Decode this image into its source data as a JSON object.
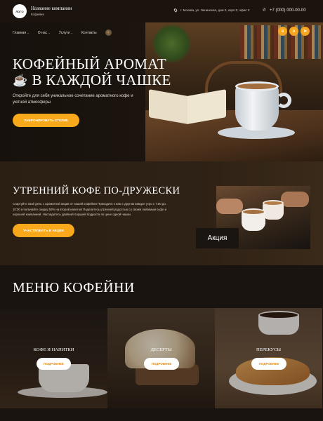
{
  "colors": {
    "accent": "#f7a81b",
    "background": "#17120d",
    "text": "#ffffff"
  },
  "header": {
    "logo_text": "ЛОГО",
    "company_name": "Название компании",
    "company_sub": "Кофейня",
    "address": "г. Москва, ул. Ленинская, дом 0, корп 0, офис 0",
    "phone": "+7 (000) 000-00-00",
    "address_icon": "map-pin-icon",
    "phone_icon": "phone-icon"
  },
  "nav": {
    "items": [
      {
        "label": "Главная",
        "has_dropdown": true
      },
      {
        "label": "О нас",
        "has_dropdown": true
      },
      {
        "label": "Услуги",
        "has_dropdown": true
      },
      {
        "label": "Контакты",
        "has_dropdown": false
      }
    ],
    "search_icon": "search-icon"
  },
  "social": [
    {
      "icon": "vk-icon",
      "glyph": "в"
    },
    {
      "icon": "odnoklassniki-icon",
      "glyph": "о"
    },
    {
      "icon": "telegram-icon",
      "glyph": "➤"
    }
  ],
  "hero": {
    "title_line1": "Кофейный аромат",
    "title_line2": "в каждой чашке",
    "title_icon": "coffee-cup-icon",
    "text": "Откройте для себя уникальное сочетание ароматного кофе и уютной атмосферы",
    "button": "Забронировать столик"
  },
  "promo": {
    "title": "Утренний кофе по-дружески",
    "text": "Стартуйте свой день с ароматной акции от нашей кофейни! Приходите к нам с другом каждое утро с 7:00 до 10:00 и получайте скидку 50% на второй напиток! Поделитесь утренней радостью со своим любимым кофе и хорошей компанией. Насладитесь двойной порцией бодрости по цене одной чашки.",
    "button": "Участвовать в акции",
    "badge": "Акция"
  },
  "menu": {
    "title": "Меню кофейни",
    "cards": [
      {
        "label": "Кофе и напитки",
        "button": "Подробнее"
      },
      {
        "label": "Десерты",
        "button": "Подробнее"
      },
      {
        "label": "Перекусы",
        "button": "Подробнее"
      }
    ]
  }
}
